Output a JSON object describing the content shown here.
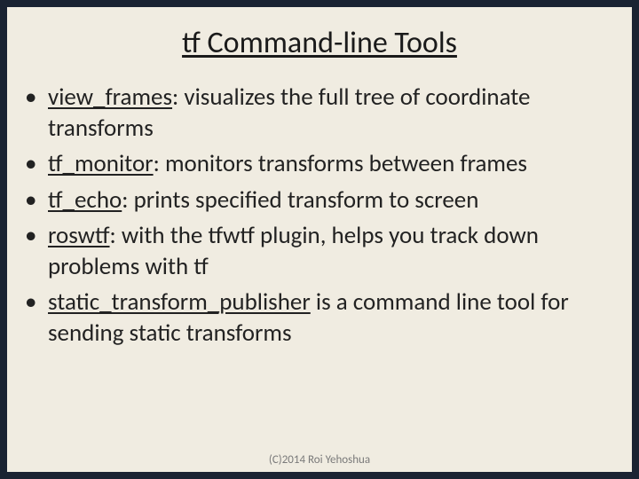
{
  "title": "tf Command-line Tools",
  "bullets": [
    {
      "cmd": "view_frames",
      "desc": ": visualizes the full tree of coordinate transforms"
    },
    {
      "cmd": "tf_monitor",
      "desc": ": monitors transforms between frames"
    },
    {
      "cmd": "tf_echo",
      "desc": ": prints specified transform to screen"
    },
    {
      "cmd": "roswtf",
      "desc": ": with the tfwtf plugin, helps you track down problems with tf"
    },
    {
      "cmd": "static_transform_publisher",
      "desc": " is a command line tool for sending static transforms"
    }
  ],
  "footer": "(C)2014 Roi Yehoshua"
}
